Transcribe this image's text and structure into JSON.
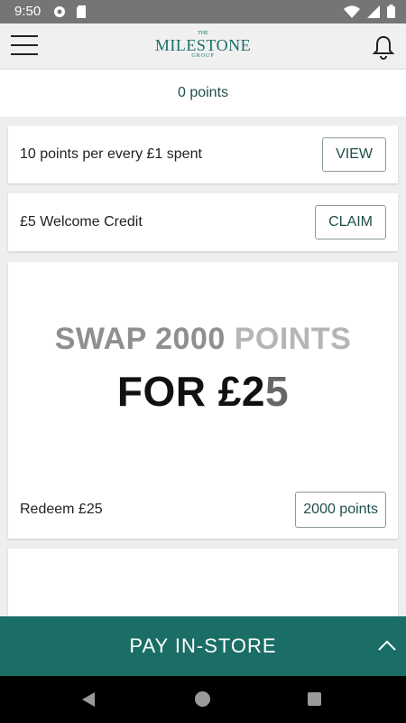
{
  "status_bar": {
    "time": "9:50",
    "icons_left": [
      "settings-icon",
      "sd-card-icon"
    ],
    "icons_right": [
      "wifi-icon",
      "signal-icon",
      "battery-icon"
    ]
  },
  "app_bar": {
    "logo": {
      "the": "THE",
      "name": "MILESTONE",
      "group": "GROUP"
    }
  },
  "points": {
    "value": "0 points"
  },
  "offers": [
    {
      "label": "10 points per every £1 spent",
      "button": "VIEW"
    },
    {
      "label": "£5 Welcome Credit",
      "button": "CLAIM"
    }
  ],
  "promo": {
    "line1_a": "SWAP 2000 ",
    "line1_b": "POINTS",
    "line2_a": "FOR £2",
    "line2_b": "5",
    "redeem_label": "Redeem £25",
    "redeem_button": "2000 points"
  },
  "pay_bar": {
    "label": "PAY IN-STORE"
  },
  "colors": {
    "brand": "#1a6e66",
    "text_accent": "#1f4f4a"
  }
}
